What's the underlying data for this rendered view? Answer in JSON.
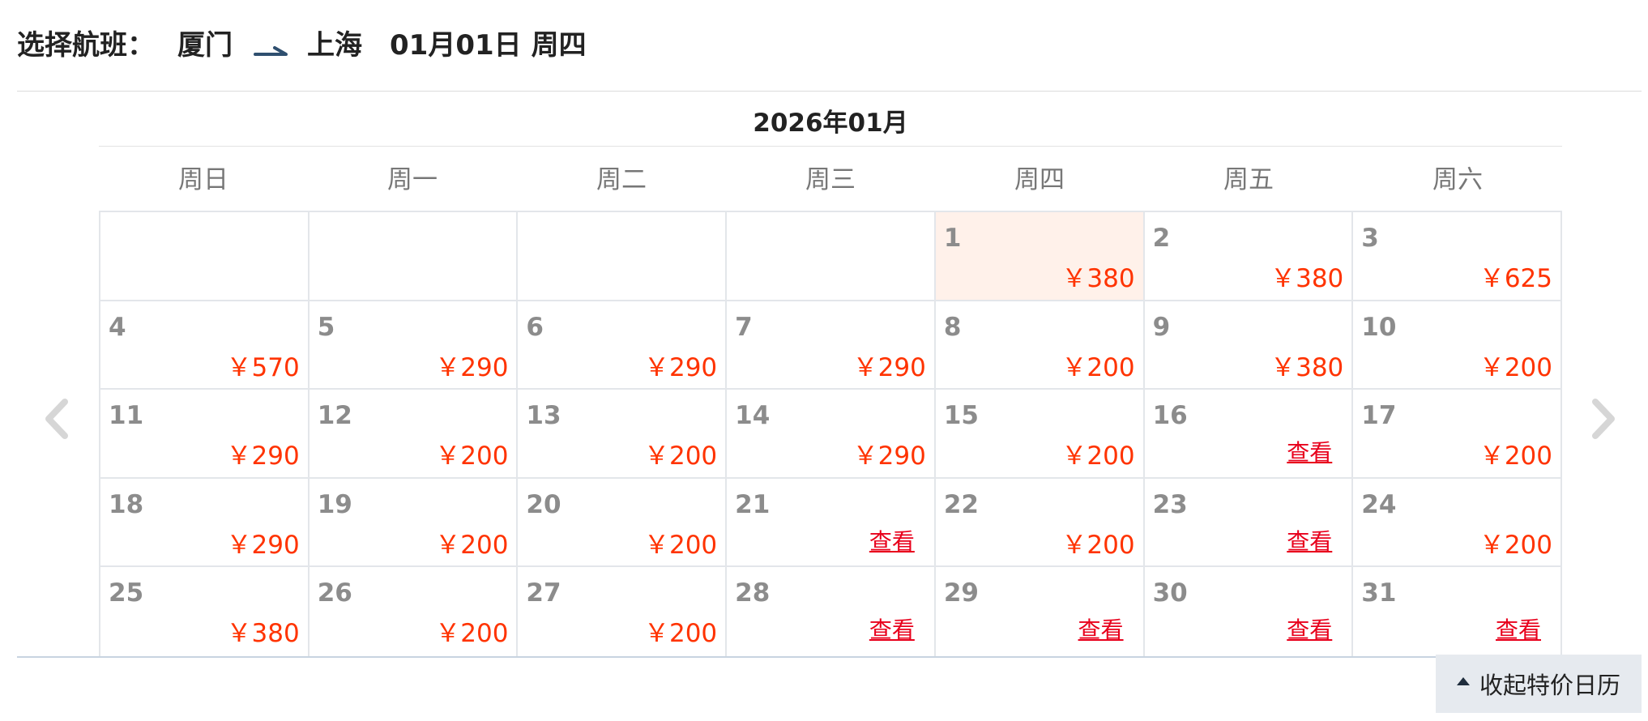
{
  "header": {
    "label": "选择航班：",
    "from": "厦门",
    "to": "上海",
    "date": "01月01日",
    "weekday": "周四"
  },
  "calendar": {
    "month_title": "2026年01月",
    "weekdays": [
      "周日",
      "周一",
      "周二",
      "周三",
      "周四",
      "周五",
      "周六"
    ],
    "leading_blanks": 4,
    "selected_day": 1,
    "days": [
      {
        "day": "1",
        "price": "￥380"
      },
      {
        "day": "2",
        "price": "￥380"
      },
      {
        "day": "3",
        "price": "￥625"
      },
      {
        "day": "4",
        "price": "￥570"
      },
      {
        "day": "5",
        "price": "￥290"
      },
      {
        "day": "6",
        "price": "￥290"
      },
      {
        "day": "7",
        "price": "￥290"
      },
      {
        "day": "8",
        "price": "￥200"
      },
      {
        "day": "9",
        "price": "￥380"
      },
      {
        "day": "10",
        "price": "￥200"
      },
      {
        "day": "11",
        "price": "￥290"
      },
      {
        "day": "12",
        "price": "￥200"
      },
      {
        "day": "13",
        "price": "￥200"
      },
      {
        "day": "14",
        "price": "￥290"
      },
      {
        "day": "15",
        "price": "￥200"
      },
      {
        "day": "16",
        "link": "查看"
      },
      {
        "day": "17",
        "price": "￥200"
      },
      {
        "day": "18",
        "price": "￥290"
      },
      {
        "day": "19",
        "price": "￥200"
      },
      {
        "day": "20",
        "price": "￥200"
      },
      {
        "day": "21",
        "link": "查看"
      },
      {
        "day": "22",
        "price": "￥200"
      },
      {
        "day": "23",
        "link": "查看"
      },
      {
        "day": "24",
        "price": "￥200"
      },
      {
        "day": "25",
        "price": "￥380"
      },
      {
        "day": "26",
        "price": "￥200"
      },
      {
        "day": "27",
        "price": "￥200"
      },
      {
        "day": "28",
        "link": "查看"
      },
      {
        "day": "29",
        "link": "查看"
      },
      {
        "day": "30",
        "link": "查看"
      },
      {
        "day": "31",
        "link": "查看"
      }
    ]
  },
  "nav": {
    "prev_icon": "chevron-left-icon",
    "next_icon": "chevron-right-icon"
  },
  "collapse_button": {
    "label": "收起特价日历",
    "icon": "caret-up-icon"
  },
  "colors": {
    "price": "#ff3300",
    "link": "#e8001c",
    "selected_bg": "#fff1ea",
    "route_arrow": "#2f4f6f"
  }
}
